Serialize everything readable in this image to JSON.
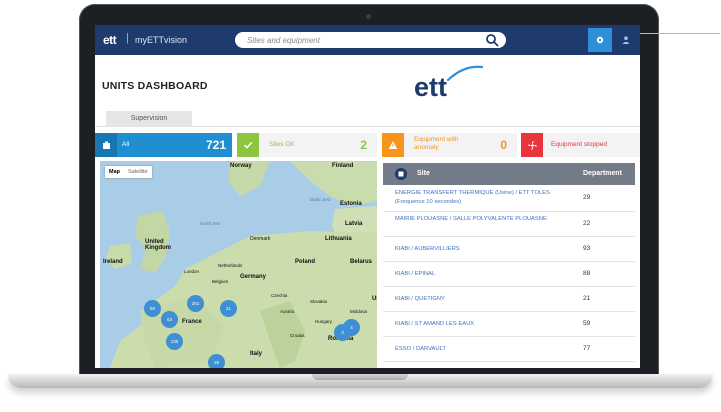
{
  "topbar": {
    "logo": "ett",
    "separator": "|",
    "app_name": "myETTvision",
    "search_placeholder": "Sites and equipment"
  },
  "page_title": "UNITS DASHBOARD",
  "brand_logo": "ett",
  "tabs": [
    {
      "label": "Supervision"
    }
  ],
  "stats": [
    {
      "label": "All",
      "value": "721",
      "color": "#1f8fd2"
    },
    {
      "label": "Sites OK",
      "value": "2",
      "color": "#8cc63f"
    },
    {
      "label": "Equipment with anomaly",
      "value": "0",
      "color": "#f7941d"
    },
    {
      "label": "Equipment stopped",
      "value": "",
      "color": "#e8343b"
    }
  ],
  "map": {
    "controls": [
      "Map",
      "Satellite"
    ],
    "labels": {
      "norway": "Norway",
      "finland": "Finland",
      "baltic_sea": "Baltic Sea",
      "estonia": "Estonia",
      "north_sea": "North Sea",
      "latvia": "Latvia",
      "denmark": "Denmark",
      "lithuania": "Lithuania",
      "uk": "United Kingdom",
      "ireland": "Ireland",
      "london": "London",
      "netherlands": "Netherlands",
      "belgium": "Belgium",
      "germany": "Germany",
      "poland": "Poland",
      "belarus": "Belarus",
      "czechia": "Czechia",
      "slovakia": "Slovakia",
      "france": "France",
      "austria": "Austria",
      "hungary": "Hungary",
      "moldova": "Moldova",
      "uk_ukraine": "Uk",
      "croatia": "Croatia",
      "romania": "Romania",
      "italy": "Italy"
    },
    "clusters": [
      "50",
      "251",
      "21",
      "63",
      "130",
      "28",
      "3",
      "4"
    ]
  },
  "table": {
    "col_site": "Site",
    "col_department": "Department",
    "rows": [
      {
        "site": "ENERGIE TRANSFERT THERMIQUE (Usine) / ETT TOLES (Frequence 10 secondes)",
        "department": "29"
      },
      {
        "site": "MAIRIE PLOUASNE / SALLE POLYVALENTE PLOUASNE",
        "department": "22"
      },
      {
        "site": "KIABI / AUBERVILLIERS",
        "department": "93"
      },
      {
        "site": "KIABI / EPINAL",
        "department": "88"
      },
      {
        "site": "KIABI / QUETIGNY",
        "department": "21"
      },
      {
        "site": "KIABI / ST AMAND LES EAUX",
        "department": "59"
      },
      {
        "site": "ESSO / DARVAULT",
        "department": "77"
      }
    ]
  }
}
